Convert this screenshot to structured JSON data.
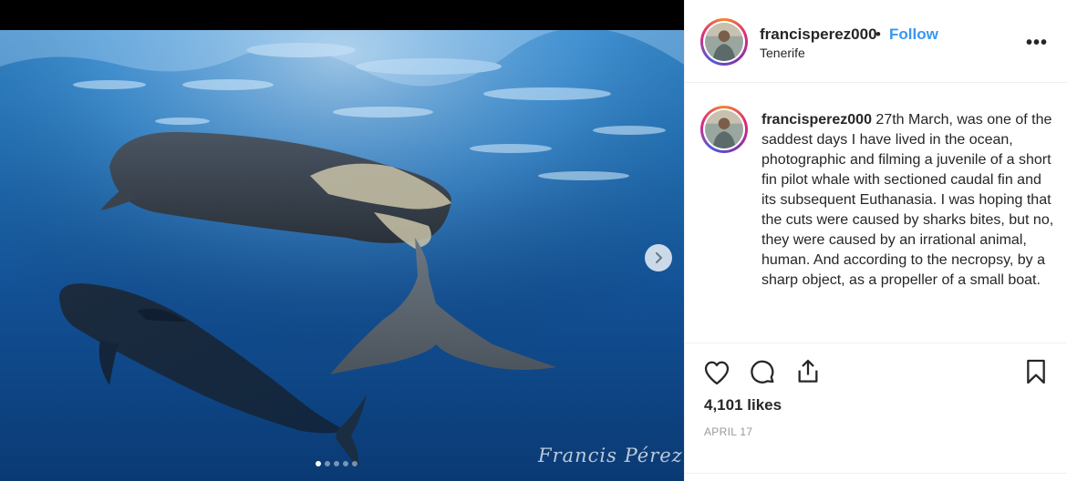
{
  "post": {
    "username": "francisperez000",
    "separator": "•",
    "follow_label": "Follow",
    "location": "Tenerife",
    "more_label": "•••",
    "caption_user": "francisperez000",
    "caption_text": "27th March, was one of the saddest days I have lived in the ocean, photographic and filming a juvenile of a short fin pilot whale with sectioned caudal fin and its subsequent Euthanasia. I was hoping that the cuts were caused by sharks bites, but no, they were caused by an irrational animal, human. And according to the necropsy, by a sharp object, as a propeller of a small boat.",
    "likes": "4,101 likes",
    "date": "APRIL 17"
  },
  "media": {
    "watermark": "Francis Pérez",
    "carousel": {
      "total": 5,
      "active": 1
    }
  },
  "icons": {
    "like": "heart-icon",
    "comment": "comment-bubble-icon",
    "share": "share-icon",
    "save": "bookmark-icon",
    "next": "chevron-right-icon"
  },
  "colors": {
    "follow": "#3897f0",
    "text": "#262626",
    "muted": "#999999",
    "ocean_deep": "#0b3e78",
    "ocean_light": "#3e8fd0"
  }
}
